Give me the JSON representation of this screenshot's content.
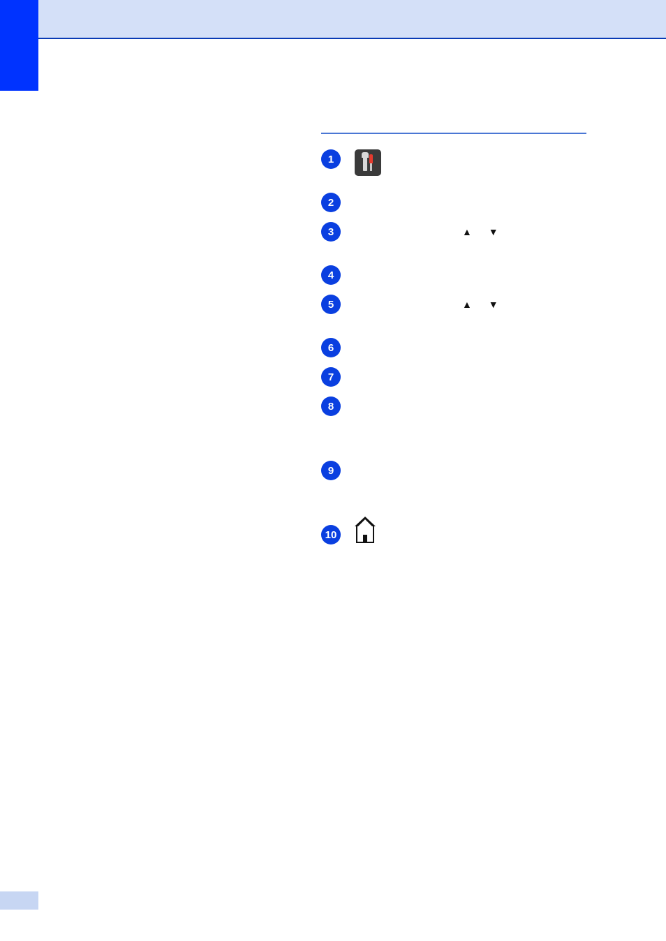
{
  "header": {
    "title": ""
  },
  "section": {
    "title": ""
  },
  "steps": [
    {
      "num": "1",
      "icon": "tools-icon",
      "text": ""
    },
    {
      "num": "2",
      "text": ""
    },
    {
      "num": "3",
      "arrows": "▲ ▼",
      "text": ""
    },
    {
      "num": "4",
      "text": ""
    },
    {
      "num": "5",
      "arrows": "▲ ▼",
      "text": ""
    },
    {
      "num": "6",
      "text": ""
    },
    {
      "num": "7",
      "text": ""
    },
    {
      "num": "8",
      "text": ""
    },
    {
      "num": "9",
      "text": ""
    },
    {
      "num": "10",
      "icon": "home-icon",
      "text": ""
    }
  ],
  "arrow_glyphs": {
    "up": "▲",
    "down": "▼"
  },
  "page_number": ""
}
